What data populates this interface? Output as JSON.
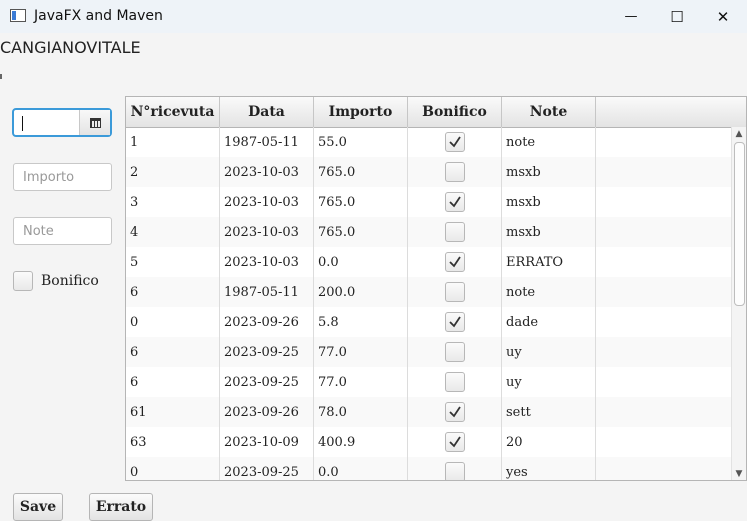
{
  "window": {
    "title": "JavaFX and Maven",
    "minimize_glyph": "—",
    "maximize_glyph": "☐",
    "close_glyph": "✕"
  },
  "header": {
    "brand": "CANGIANOVITALE"
  },
  "form": {
    "date_value": "",
    "importo_placeholder": "Importo",
    "note_placeholder": "Note",
    "bonifico_label": "Bonifico",
    "bonifico_checked": false
  },
  "table": {
    "columns": [
      "N°ricevuta",
      "Data",
      "Importo",
      "Bonifico",
      "Note",
      ""
    ],
    "rows": [
      {
        "ricevuta": "1",
        "data": "1987-05-11",
        "importo": "55.0",
        "bonifico": true,
        "note": "note"
      },
      {
        "ricevuta": "2",
        "data": "2023-10-03",
        "importo": "765.0",
        "bonifico": false,
        "note": "msxb"
      },
      {
        "ricevuta": "3",
        "data": "2023-10-03",
        "importo": "765.0",
        "bonifico": true,
        "note": "msxb"
      },
      {
        "ricevuta": "4",
        "data": "2023-10-03",
        "importo": "765.0",
        "bonifico": false,
        "note": "msxb"
      },
      {
        "ricevuta": "5",
        "data": "2023-10-03",
        "importo": "0.0",
        "bonifico": true,
        "note": "ERRATO"
      },
      {
        "ricevuta": "6",
        "data": "1987-05-11",
        "importo": "200.0",
        "bonifico": false,
        "note": "note"
      },
      {
        "ricevuta": "0",
        "data": "2023-09-26",
        "importo": "5.8",
        "bonifico": true,
        "note": "dade"
      },
      {
        "ricevuta": "6",
        "data": "2023-09-25",
        "importo": "77.0",
        "bonifico": false,
        "note": "uy"
      },
      {
        "ricevuta": "6",
        "data": "2023-09-25",
        "importo": "77.0",
        "bonifico": false,
        "note": "uy"
      },
      {
        "ricevuta": "61",
        "data": "2023-09-26",
        "importo": "78.0",
        "bonifico": true,
        "note": "sett"
      },
      {
        "ricevuta": "63",
        "data": "2023-10-09",
        "importo": "400.9",
        "bonifico": true,
        "note": "20"
      },
      {
        "ricevuta": "0",
        "data": "2023-09-25",
        "importo": "0.0",
        "bonifico": false,
        "note": "yes"
      }
    ]
  },
  "buttons": {
    "save": "Save",
    "errato": "Errato"
  },
  "scrollbar": {
    "up_glyph": "▲",
    "down_glyph": "▼"
  },
  "colors": {
    "focus": "#3b9ad9",
    "check": "#333333"
  }
}
